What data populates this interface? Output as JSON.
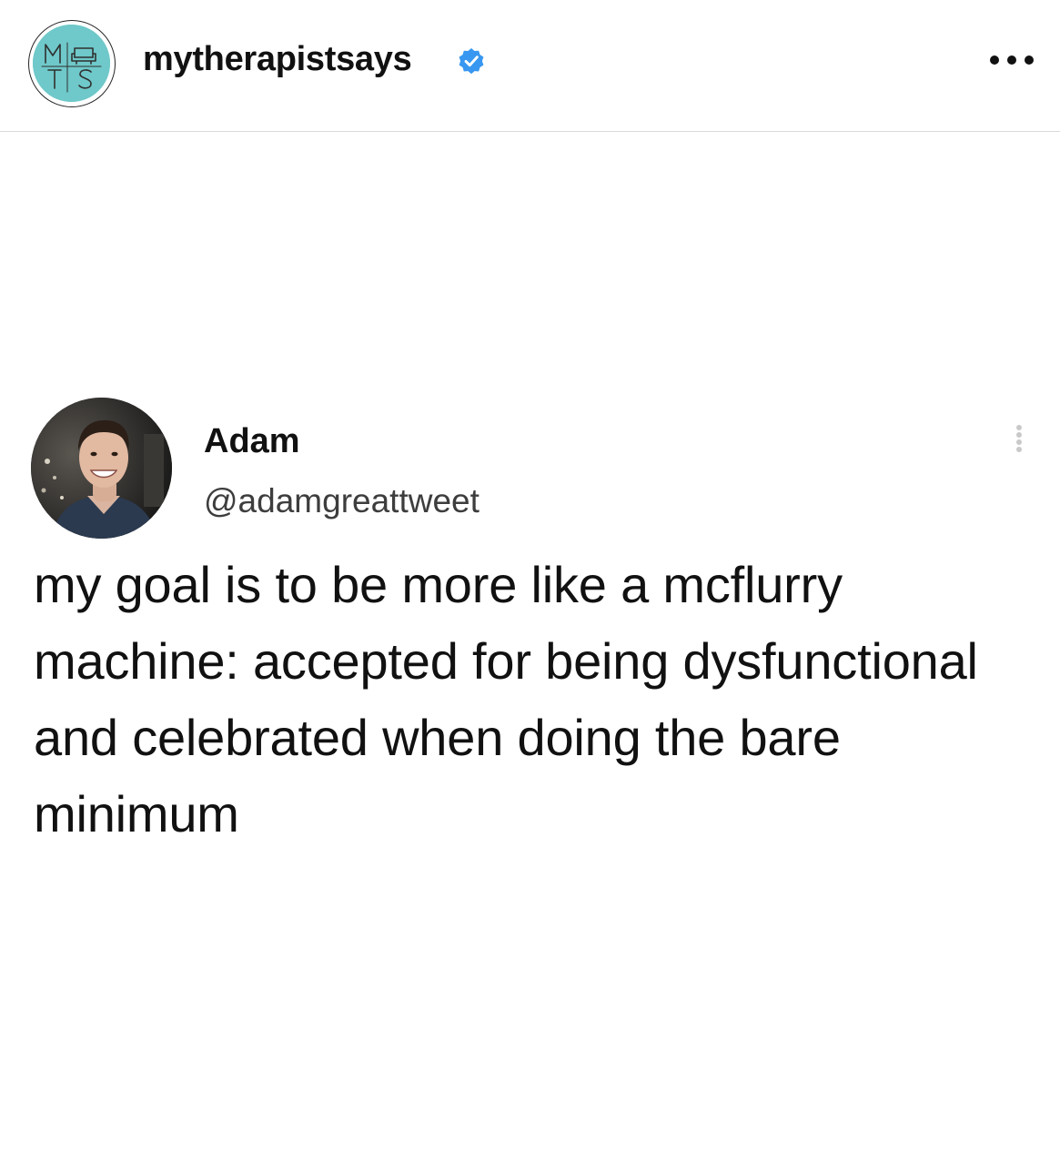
{
  "post_header": {
    "account_name": "mytherapistsays",
    "avatar": {
      "logo_letters": [
        "M",
        "T",
        "S"
      ],
      "background_color": "#6fc8c9",
      "icon": "couch-icon"
    },
    "verified_icon": "verified-badge-icon",
    "verified_color": "#3897f0",
    "more_icon": "more-horizontal-icon"
  },
  "tweet": {
    "display_name": "Adam",
    "handle": "@adamgreattweet",
    "avatar_icon": "profile-photo",
    "menu_icon": "more-vertical-icon",
    "text": "my goal is to be more like a mcflurry machine: accepted for being dysfunctional and celebrated when doing the bare minimum"
  }
}
